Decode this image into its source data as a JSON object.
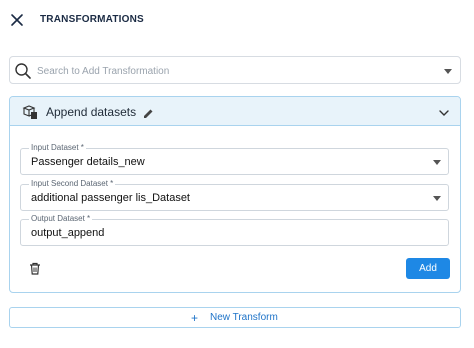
{
  "header": {
    "title": "TRANSFORMATIONS",
    "close_icon": "close-icon"
  },
  "search": {
    "placeholder": "Search to Add Transformation",
    "icon": "search-icon",
    "dropdown_icon": "caret-down-icon"
  },
  "transform": {
    "title": "Append datasets",
    "icon": "append-datasets-icon",
    "edit_icon": "pencil-icon",
    "collapse_icon": "chevron-down-icon",
    "fields": [
      {
        "label": "Input Dataset *",
        "value": "Passenger details_new",
        "type": "select"
      },
      {
        "label": "Input Second Dataset *",
        "value": "additional passenger lis_Dataset",
        "type": "select"
      },
      {
        "label": "Output Dataset *",
        "value": "output_append",
        "type": "text"
      }
    ],
    "delete_icon": "trash-icon",
    "add_label": "Add"
  },
  "footer": {
    "plus_glyph": "+",
    "new_transform_label": "New Transform"
  },
  "colors": {
    "accent": "#1e88e5",
    "card_border": "#a9d3ee",
    "card_header_bg": "#e8f3fa",
    "title_text": "#1b2b44"
  }
}
